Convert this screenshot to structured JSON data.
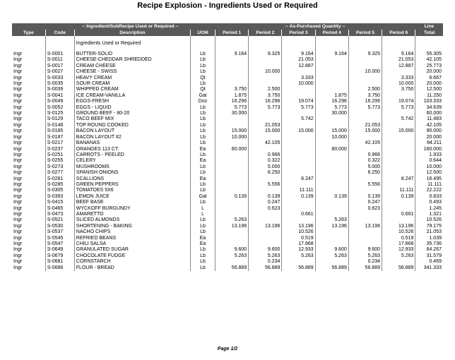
{
  "report": {
    "title": "Recipe Explosion - Ingredients Used or Required",
    "group_left": "-- Ingredient/SubRecipe Used or Required --",
    "group_right": "-- As-Purchased Quantity --",
    "group_line": "Line",
    "columns": [
      "Type",
      "Code",
      "Description",
      "UOM",
      "Period 1",
      "Period 2",
      "Period 3",
      "Period 4",
      "Period 5",
      "Period 6",
      "Total"
    ],
    "section_label": "Ingredients Used or Required",
    "footer": "Page 1/2"
  },
  "rows": [
    [
      "Ingr",
      "S-0001",
      "BUTTER-SOLID",
      "Lb",
      "9.164",
      "9.325",
      "9.164",
      "9.164",
      "9.325",
      "9.164",
      "55.305"
    ],
    [
      "Ingr",
      "S-0011",
      "CHEESE-CHEDDAR SHREDDED",
      "Lb",
      "",
      "",
      "21.053",
      "",
      "",
      "21.053",
      "42.105"
    ],
    [
      "Ingr",
      "S-0017",
      "CREAM CHEESE",
      "Lb",
      "",
      "",
      "12.887",
      "",
      "",
      "12.887",
      "25.773"
    ],
    [
      "Ingr",
      "S-0027",
      "CHEESE - SWISS",
      "Lb",
      "",
      "10.000",
      "",
      "",
      "10.000",
      "",
      "20.000"
    ],
    [
      "Ingr",
      "S-0033",
      "HEAVY CREAM",
      "Qt",
      "",
      "",
      "3.333",
      "",
      "",
      "3.333",
      "6.667"
    ],
    [
      "Ingr",
      "S-0035",
      "SOUR CREAM",
      "Lb",
      "",
      "",
      "10.000",
      "",
      "",
      "10.000",
      "20.000"
    ],
    [
      "Ingr",
      "S-0039",
      "WHIPPED CREAM",
      "Qt",
      "3.750",
      "2.500",
      "",
      "",
      "2.500",
      "3.750",
      "12.500"
    ],
    [
      "Ingr",
      "S-0041",
      "ICE CREAM-VANILLA",
      "Gal",
      "1.875",
      "3.750",
      "",
      "1.875",
      "3.750",
      "",
      "11.250"
    ],
    [
      "Ingr",
      "S-0049",
      "EGGS-FRESH",
      "Doz",
      "16.296",
      "16.296",
      "19.074",
      "16.296",
      "16.296",
      "19.074",
      "103.333"
    ],
    [
      "Ingr",
      "S-0052",
      "EGGS - LIQUID",
      "Lb",
      "5.773",
      "5.773",
      "5.773",
      "5.773",
      "5.773",
      "5.773",
      "34.639"
    ],
    [
      "Ingr",
      "S-0125",
      "GROUND BEEF - 80-20",
      "Lb",
      "30.000",
      "",
      "",
      "30.000",
      "",
      "",
      "60.000"
    ],
    [
      "Ingr",
      "S-0129",
      "TACO BEEF MIX",
      "Lb",
      "",
      "",
      "5.742",
      "",
      "",
      "5.742",
      "11.483"
    ],
    [
      "Ingr",
      "S-0148",
      "TOP ROUND COOKED",
      "Lb",
      "",
      "21.053",
      "",
      "",
      "21.053",
      "",
      "42.105"
    ],
    [
      "Ingr",
      "S-0185",
      "BACON LAYOUT",
      "Lb",
      "15.000",
      "15.000",
      "15.000",
      "15.000",
      "15.000",
      "15.000",
      "90.000"
    ],
    [
      "Ingr",
      "S-0187",
      "BACON LAYOUT #2",
      "Lb",
      "10.000",
      "",
      "",
      "10.000",
      "",
      "",
      "20.000"
    ],
    [
      "Ingr",
      "S-0217",
      "BANANAS",
      "Lb",
      "",
      "42.105",
      "",
      "",
      "42.105",
      "",
      "84.211"
    ],
    [
      "Ingr",
      "S-0237",
      "ORANGES 113 CT.",
      "Ea",
      "80.000",
      "",
      "",
      "80.000",
      "",
      "",
      "160.000"
    ],
    [
      "Ingr",
      "S-0251",
      "CARROTS - PEELED",
      "Lb",
      "",
      "0.966",
      "",
      "",
      "0.966",
      "",
      "1.933"
    ],
    [
      "Ingr",
      "S-0255",
      "CELERY",
      "Ea",
      "",
      "0.322",
      "",
      "",
      "0.322",
      "",
      "0.644"
    ],
    [
      "Ingr",
      "S-0273",
      "MUSHROOMS",
      "Lb",
      "",
      "5.000",
      "",
      "",
      "5.000",
      "",
      "10.000"
    ],
    [
      "Ingr",
      "S-0277",
      "SPANISH ONIONS",
      "Lb",
      "",
      "6.250",
      "",
      "",
      "6.250",
      "",
      "12.500"
    ],
    [
      "Ingr",
      "S-0281",
      "SCALLIONS",
      "Ea",
      "",
      "",
      "8.247",
      "",
      "",
      "8.247",
      "16.495"
    ],
    [
      "Ingr",
      "S-0285",
      "GREEN PEPPERS",
      "Lb",
      "",
      "5.556",
      "",
      "",
      "5.556",
      "",
      "11.111"
    ],
    [
      "Ingr",
      "S-0305",
      "TOMATOES 5X6",
      "Lb",
      "",
      "",
      "11.111",
      "",
      "",
      "11.111",
      "22.222"
    ],
    [
      "Ingr",
      "S-0393",
      "LEMON JUICE",
      "Gal",
      "0.139",
      "0.139",
      "0.139",
      "0.139",
      "0.139",
      "0.139",
      "0.833"
    ],
    [
      "Ingr",
      "S-0415",
      "BEEF BASE",
      "Lb",
      "",
      "0.247",
      "",
      "",
      "0.247",
      "",
      "0.493"
    ],
    [
      "Ingr",
      "S-0465",
      "WYCKOFF BURGUNDY",
      "L",
      "",
      "0.623",
      "",
      "",
      "0.623",
      "",
      "1.245"
    ],
    [
      "Ingr",
      "S-0473",
      "AMARETTO",
      "L",
      "",
      "",
      "0.661",
      "",
      "",
      "0.661",
      "1.321"
    ],
    [
      "Ingr",
      "S-0521",
      "SLICED ALMONDS",
      "Lb",
      "5.263",
      "",
      "",
      "5.263",
      "",
      "",
      "10.526"
    ],
    [
      "Ingr",
      "S-0530",
      "SHORTENING - BAKING",
      "Lb",
      "13.196",
      "13.196",
      "13.196",
      "13.196",
      "13.196",
      "13.196",
      "79.175"
    ],
    [
      "Ingr",
      "S-0537",
      "NACHO CHIPS",
      "Lb",
      "",
      "",
      "10.526",
      "",
      "",
      "10.526",
      "21.053"
    ],
    [
      "Ingr",
      "S-0545",
      "REFRIED BEANS",
      "Ea",
      "",
      "",
      "0.519",
      "",
      "",
      "0.519",
      "1.039"
    ],
    [
      "Ingr",
      "S-0547",
      "CHILI SALSA",
      "Ea",
      "",
      "",
      "17.868",
      "",
      "",
      "17.868",
      "35.736"
    ],
    [
      "Ingr",
      "S-0649",
      "GRANULATED SUGAR",
      "Lb",
      "9.600",
      "9.600",
      "12.933",
      "9.600",
      "9.600",
      "12.933",
      "64.267"
    ],
    [
      "Ingr",
      "S-0679",
      "CHOCOLATE FUDGE",
      "Lb",
      "5.263",
      "5.263",
      "5.263",
      "5.263",
      "5.263",
      "5.263",
      "31.579"
    ],
    [
      "Ingr",
      "S-0681",
      "CORNSTARCH",
      "Lb",
      "",
      "0.234",
      "",
      "",
      "0.234",
      "",
      "0.469"
    ],
    [
      "Ingr",
      "S-0688",
      "FLOUR - BREAD",
      "Lb",
      "56.889",
      "56.889",
      "56.889",
      "56.889",
      "56.889",
      "56.889",
      "341.333"
    ]
  ]
}
